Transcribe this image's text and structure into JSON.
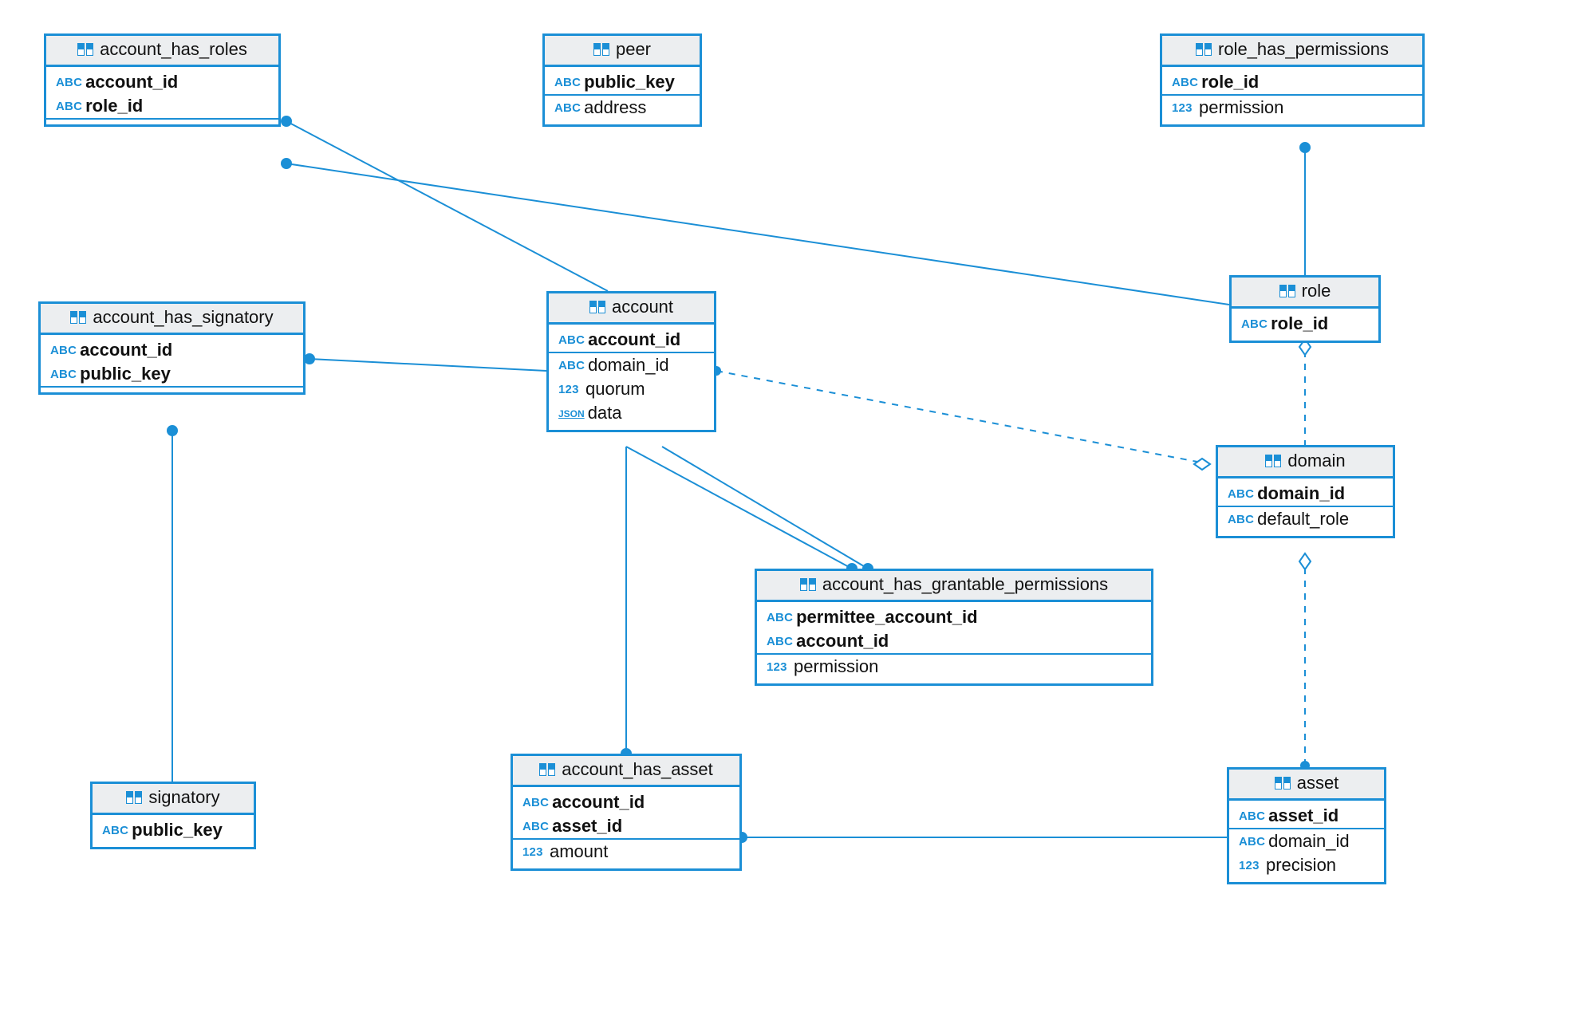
{
  "tables": {
    "account_has_roles": {
      "title": "account_has_roles",
      "cols": {
        "c0": "account_id",
        "c1": "role_id"
      }
    },
    "peer": {
      "title": "peer",
      "cols": {
        "c0": "public_key",
        "c1": "address"
      }
    },
    "role_has_permissions": {
      "title": "role_has_permissions",
      "cols": {
        "c0": "role_id",
        "c1": "permission"
      }
    },
    "account_has_signatory": {
      "title": "account_has_signatory",
      "cols": {
        "c0": "account_id",
        "c1": "public_key"
      }
    },
    "account": {
      "title": "account",
      "cols": {
        "c0": "account_id",
        "c1": "domain_id",
        "c2": "quorum",
        "c3": "data"
      }
    },
    "role": {
      "title": "role",
      "cols": {
        "c0": "role_id"
      }
    },
    "domain": {
      "title": "domain",
      "cols": {
        "c0": "domain_id",
        "c1": "default_role"
      }
    },
    "account_has_grantable_permissions": {
      "title": "account_has_grantable_permissions",
      "cols": {
        "c0": "permittee_account_id",
        "c1": "account_id",
        "c2": "permission"
      }
    },
    "signatory": {
      "title": "signatory",
      "cols": {
        "c0": "public_key"
      }
    },
    "account_has_asset": {
      "title": "account_has_asset",
      "cols": {
        "c0": "account_id",
        "c1": "asset_id",
        "c2": "amount"
      }
    },
    "asset": {
      "title": "asset",
      "cols": {
        "c0": "asset_id",
        "c1": "domain_id",
        "c2": "precision"
      }
    }
  },
  "relations": [
    {
      "from": "account_has_roles",
      "to": "account",
      "style": "solid"
    },
    {
      "from": "account_has_roles",
      "to": "role",
      "style": "solid"
    },
    {
      "from": "role_has_permissions",
      "to": "role",
      "style": "solid"
    },
    {
      "from": "account_has_signatory",
      "to": "account",
      "style": "solid"
    },
    {
      "from": "account_has_signatory",
      "to": "signatory",
      "style": "solid"
    },
    {
      "from": "account",
      "to": "domain",
      "style": "dashed"
    },
    {
      "from": "domain",
      "to": "role",
      "style": "dashed"
    },
    {
      "from": "account_has_grantable_permissions",
      "to": "account",
      "style": "solid",
      "note": "double"
    },
    {
      "from": "account_has_asset",
      "to": "account",
      "style": "solid"
    },
    {
      "from": "account_has_asset",
      "to": "asset",
      "style": "solid"
    },
    {
      "from": "asset",
      "to": "domain",
      "style": "dashed"
    }
  ]
}
